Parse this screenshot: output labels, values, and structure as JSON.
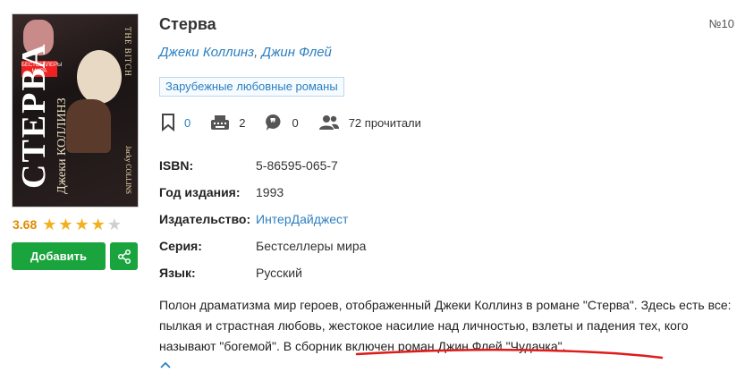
{
  "book": {
    "title": "Стерва",
    "number": "№10",
    "authors": [
      "Джеки Коллинз",
      "Джин Флей"
    ],
    "author_separator": ",",
    "genre": "Зарубежные любовные романы",
    "rating": "3.68",
    "rating_stars": 3.68,
    "max_stars": 5
  },
  "cover": {
    "title": "СТЕРВА",
    "author": "Джеки КОЛЛИНЗ",
    "series": "БЕСТСЕЛЛЕРЫ МИРА",
    "original_title": "THE BITCH",
    "original_author": "Jacky COLLINS"
  },
  "actions": {
    "add_label": "Добавить"
  },
  "stats": {
    "bookmarks": "0",
    "reviews": "2",
    "quotes": "0",
    "readers": "72 прочитали"
  },
  "meta": [
    {
      "label": "ISBN:",
      "value": "5-86595-065-7",
      "link": false
    },
    {
      "label": "Год издания:",
      "value": "1993",
      "link": false
    },
    {
      "label": "Издательство:",
      "value": "ИнтерДайджест",
      "link": true
    },
    {
      "label": "Серия:",
      "value": "Бестселлеры мира",
      "link": false
    },
    {
      "label": "Язык:",
      "value": "Русский",
      "link": false
    }
  ],
  "description": {
    "text": "Полон драматизма мир героев, отображенный Джеки Коллинз в романе \"Стерва\". Здесь есть все: пылкая и страстная любовь, жестокое насилие над личностью, взлеты и падения тех, кого называют \"богемой\". В сборник включен роман Джин Флей \"Чудачка\"."
  },
  "colors": {
    "accent": "#2b7fc1",
    "green": "#1aa43d",
    "star": "#f2b01e",
    "rating": "#e08a00",
    "annotation": "#e01b1b"
  }
}
